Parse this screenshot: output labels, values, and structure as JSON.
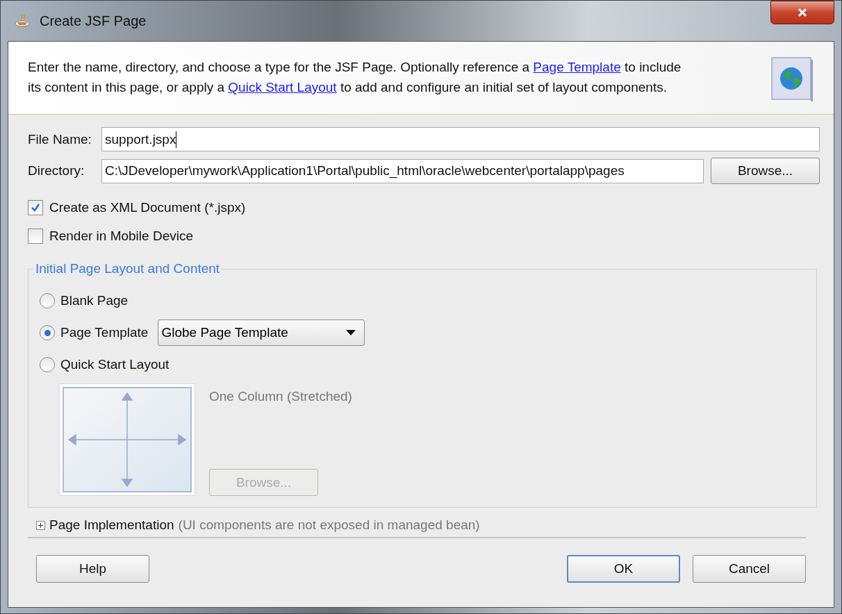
{
  "window": {
    "title": "Create JSF Page"
  },
  "description": [
    {
      "kind": "text",
      "text": "Enter the name, directory, and choose a type for the JSF Page. Optionally reference a "
    },
    {
      "kind": "link",
      "text": "Page Template"
    },
    {
      "kind": "text",
      "text": " to include its content in this page, or apply a "
    },
    {
      "kind": "link",
      "text": "Quick Start Layout"
    },
    {
      "kind": "text",
      "text": " to add and configure an initial set of layout components."
    }
  ],
  "fields": [
    {
      "label": "File Name:",
      "value": "support.jspx",
      "focused": true
    },
    {
      "label": "Directory:",
      "value": "C:\\JDeveloper\\mywork\\Application1\\Portal\\public_html\\oracle\\webcenter\\portalapp\\pages",
      "button": "Browse...",
      "focused": false
    }
  ],
  "checkboxes": [
    {
      "label": "Create as XML Document (*.jspx)",
      "checked": true
    },
    {
      "label": "Render in Mobile Device",
      "checked": false
    }
  ],
  "layout_group": {
    "title": "Initial Page Layout and Content",
    "options": [
      {
        "label": "Blank Page",
        "selected": false
      },
      {
        "label": "Page Template",
        "selected": true,
        "dropdown": "Globe Page Template"
      },
      {
        "label": "Quick Start Layout",
        "selected": false
      }
    ],
    "preview": {
      "name": "One Column (Stretched)",
      "button": "Browse...",
      "disabled": true
    }
  },
  "implementation": {
    "label": "Page Implementation",
    "note": "(UI components are not exposed in managed bean)",
    "expanded": false
  },
  "buttons": [
    {
      "label": "Help",
      "default": false
    },
    {
      "label": "OK",
      "default": true
    },
    {
      "label": "Cancel",
      "default": false
    }
  ]
}
